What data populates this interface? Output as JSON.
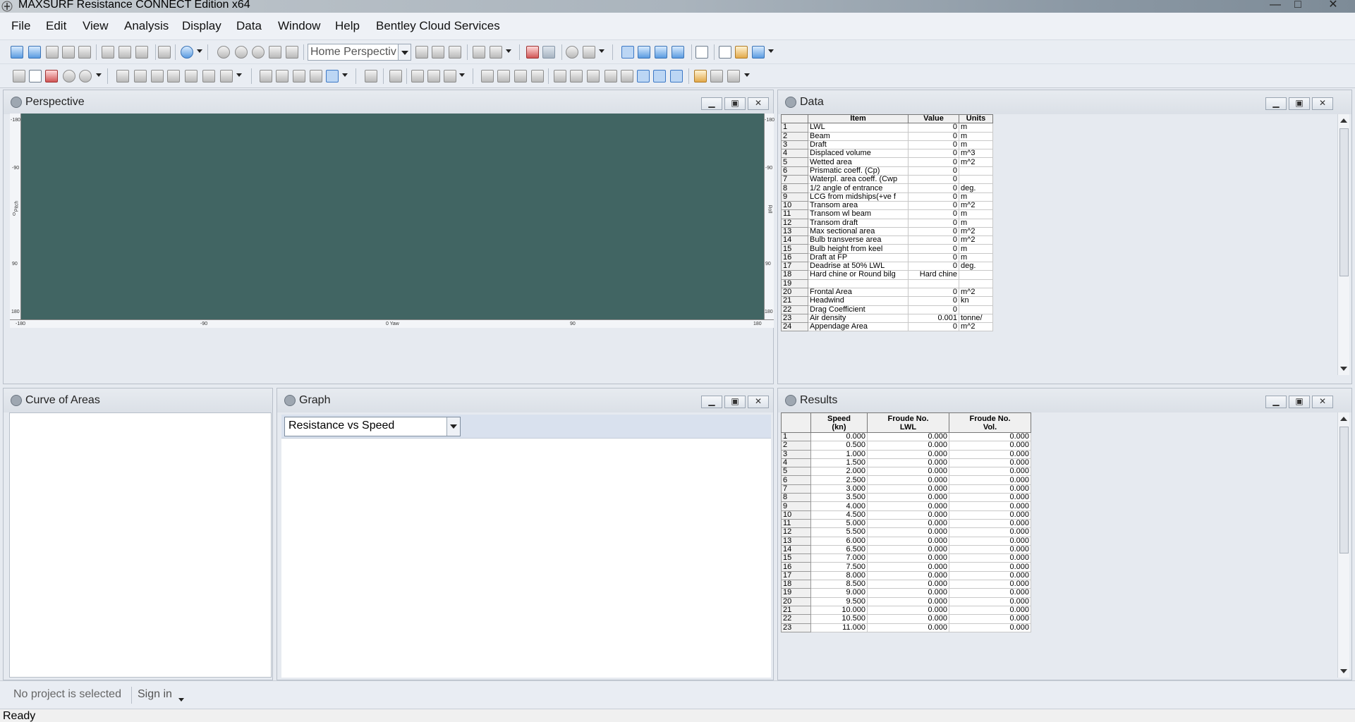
{
  "window": {
    "title": "MAXSURF Resistance CONNECT Edition x64",
    "min_glyph": "—",
    "max_glyph": "□",
    "close_glyph": "✕"
  },
  "menu": [
    "File",
    "Edit",
    "View",
    "Analysis",
    "Display",
    "Data",
    "Window",
    "Help",
    "Bentley Cloud Services"
  ],
  "toolbar": {
    "view_combo_value": "Home Perspectiv"
  },
  "panels": {
    "perspective": {
      "title": "Perspective"
    },
    "data": {
      "title": "Data"
    },
    "curve_of_areas": {
      "title": "Curve of Areas"
    },
    "graph": {
      "title": "Graph",
      "combo_value": "Resistance vs Speed"
    },
    "results": {
      "title": "Results"
    }
  },
  "perspective_rulers": {
    "left": [
      "-180",
      "-90",
      "Pitch",
      "0",
      "90",
      "180"
    ],
    "right": [
      "-180",
      "-90",
      "Roll",
      "90",
      "180"
    ],
    "bottom": [
      "-180",
      "-90",
      "0 Yaw",
      "90",
      "180"
    ]
  },
  "data_table": {
    "headers": [
      "",
      "Item",
      "Value",
      "Units"
    ],
    "rows": [
      [
        "1",
        "LWL",
        "0",
        "m"
      ],
      [
        "2",
        "Beam",
        "0",
        "m"
      ],
      [
        "3",
        "Draft",
        "0",
        "m"
      ],
      [
        "4",
        "Displaced volume",
        "0",
        "m^3"
      ],
      [
        "5",
        "Wetted area",
        "0",
        "m^2"
      ],
      [
        "6",
        "Prismatic coeff. (Cp)",
        "0",
        ""
      ],
      [
        "7",
        "Waterpl. area coeff. (Cwp",
        "0",
        ""
      ],
      [
        "8",
        "1/2 angle of entrance",
        "0",
        "deg."
      ],
      [
        "9",
        "LCG from midships(+ve f",
        "0",
        "m"
      ],
      [
        "10",
        "Transom area",
        "0",
        "m^2"
      ],
      [
        "11",
        "Transom wl beam",
        "0",
        "m"
      ],
      [
        "12",
        "Transom draft",
        "0",
        "m"
      ],
      [
        "13",
        "Max sectional area",
        "0",
        "m^2"
      ],
      [
        "14",
        "Bulb transverse area",
        "0",
        "m^2"
      ],
      [
        "15",
        "Bulb height from keel",
        "0",
        "m"
      ],
      [
        "16",
        "Draft at FP",
        "0",
        "m"
      ],
      [
        "17",
        "Deadrise at 50% LWL",
        "0",
        "deg."
      ],
      [
        "18",
        "Hard chine or Round bilg",
        "Hard chine",
        ""
      ],
      [
        "19",
        "",
        "",
        ""
      ],
      [
        "20",
        "Frontal Area",
        "0",
        "m^2"
      ],
      [
        "21",
        "Headwind",
        "0",
        "kn"
      ],
      [
        "22",
        "Drag Coefficient",
        "0",
        ""
      ],
      [
        "23",
        "Air density",
        "0.001",
        "tonne/"
      ],
      [
        "24",
        "Appendage Area",
        "0",
        "m^2"
      ]
    ]
  },
  "results_table": {
    "headers": [
      "",
      "Speed\n(kn)",
      "Froude No.\nLWL",
      "Froude No.\nVol."
    ],
    "rows": [
      [
        "1",
        "0.000",
        "0.000",
        "0.000"
      ],
      [
        "2",
        "0.500",
        "0.000",
        "0.000"
      ],
      [
        "3",
        "1.000",
        "0.000",
        "0.000"
      ],
      [
        "4",
        "1.500",
        "0.000",
        "0.000"
      ],
      [
        "5",
        "2.000",
        "0.000",
        "0.000"
      ],
      [
        "6",
        "2.500",
        "0.000",
        "0.000"
      ],
      [
        "7",
        "3.000",
        "0.000",
        "0.000"
      ],
      [
        "8",
        "3.500",
        "0.000",
        "0.000"
      ],
      [
        "9",
        "4.000",
        "0.000",
        "0.000"
      ],
      [
        "10",
        "4.500",
        "0.000",
        "0.000"
      ],
      [
        "11",
        "5.000",
        "0.000",
        "0.000"
      ],
      [
        "12",
        "5.500",
        "0.000",
        "0.000"
      ],
      [
        "13",
        "6.000",
        "0.000",
        "0.000"
      ],
      [
        "14",
        "6.500",
        "0.000",
        "0.000"
      ],
      [
        "15",
        "7.000",
        "0.000",
        "0.000"
      ],
      [
        "16",
        "7.500",
        "0.000",
        "0.000"
      ],
      [
        "17",
        "8.000",
        "0.000",
        "0.000"
      ],
      [
        "18",
        "8.500",
        "0.000",
        "0.000"
      ],
      [
        "19",
        "9.000",
        "0.000",
        "0.000"
      ],
      [
        "20",
        "9.500",
        "0.000",
        "0.000"
      ],
      [
        "21",
        "10.000",
        "0.000",
        "0.000"
      ],
      [
        "22",
        "10.500",
        "0.000",
        "0.000"
      ],
      [
        "23",
        "11.000",
        "0.000",
        "0.000"
      ]
    ]
  },
  "project_bar": {
    "no_project": "No project is selected",
    "sign_in": "Sign in"
  },
  "status": {
    "text": "Ready"
  }
}
